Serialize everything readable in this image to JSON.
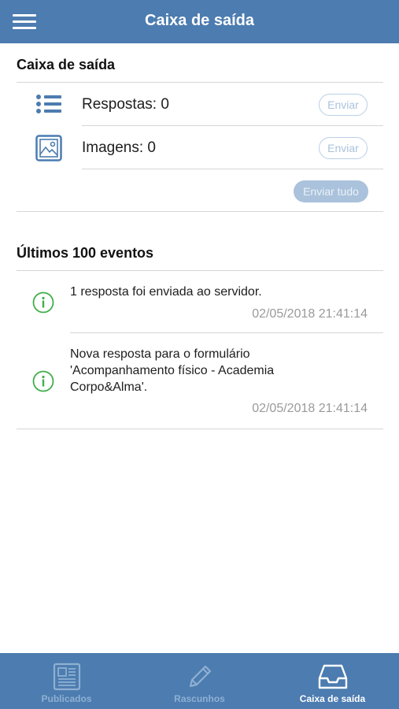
{
  "header": {
    "title": "Caixa de saída"
  },
  "outbox": {
    "title": "Caixa de saída",
    "rows": [
      {
        "label": "Respostas: 0",
        "button": "Enviar",
        "icon": "list-icon"
      },
      {
        "label": "Imagens: 0",
        "button": "Enviar",
        "icon": "image-icon"
      }
    ],
    "send_all": "Enviar tudo"
  },
  "events": {
    "title": "Últimos 100 eventos",
    "items": [
      {
        "message": "1 resposta foi enviada ao servidor.",
        "timestamp": "02/05/2018 21:41:14",
        "icon": "info-icon"
      },
      {
        "message": "Nova resposta para o formulário 'Acompanhamento físico - Academia Corpo&Alma'.",
        "timestamp": "02/05/2018 21:41:14",
        "icon": "info-icon"
      }
    ]
  },
  "nav": {
    "items": [
      {
        "label": "Publicados",
        "icon": "newspaper-icon",
        "active": false
      },
      {
        "label": "Rascunhos",
        "icon": "pencil-icon",
        "active": false
      },
      {
        "label": "Caixa de saída",
        "icon": "inbox-tray-icon",
        "active": true
      }
    ]
  },
  "colors": {
    "primary": "#4c7cb0",
    "info_green": "#3fae49",
    "muted": "#9a9a9a",
    "button_light": "#aac2dc"
  }
}
